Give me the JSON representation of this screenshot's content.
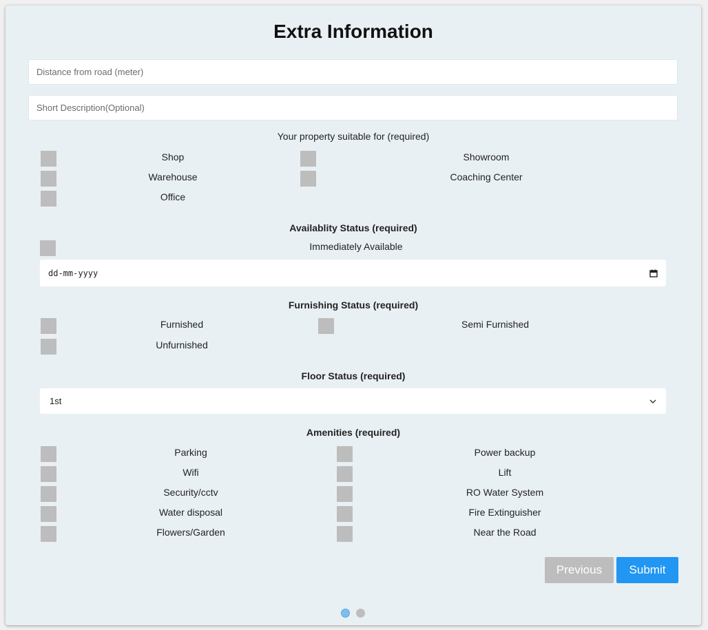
{
  "form": {
    "title": "Extra Information",
    "distance_placeholder": "Distance from road (meter)",
    "description_placeholder": "Short Description(Optional)"
  },
  "suitable": {
    "title": "Your property suitable for (required)",
    "options": [
      "Shop",
      "Showroom",
      "Warehouse",
      "Coaching Center",
      "Office"
    ]
  },
  "availability": {
    "title": "Availablity Status (required)",
    "option": "Immediately Available",
    "date_placeholder": "dd-mm-yyyy",
    "calendar_icon": "calendar-icon"
  },
  "furnishing": {
    "title": "Furnishing Status (required)",
    "options": [
      "Furnished",
      "Semi Furnished",
      "Unfurnished"
    ]
  },
  "floor": {
    "title": "Floor Status (required)",
    "selected": "1st",
    "chevron_icon": "chevron-down-icon"
  },
  "amenities": {
    "title": "Amenities (required)",
    "options": [
      "Parking",
      "Power backup",
      "Wifi",
      "Lift",
      "Security/cctv",
      "RO Water System",
      "Water disposal",
      "Fire Extinguisher",
      "Flowers/Garden",
      "Near the Road"
    ]
  },
  "buttons": {
    "previous": "Previous",
    "submit": "Submit"
  },
  "pagination": {
    "current": 1,
    "total": 2
  },
  "colors": {
    "card_bg": "#e9f0f4",
    "checkbox": "#bdbdbd",
    "primary": "#2196f3",
    "disabled": "#bdbdbd"
  }
}
